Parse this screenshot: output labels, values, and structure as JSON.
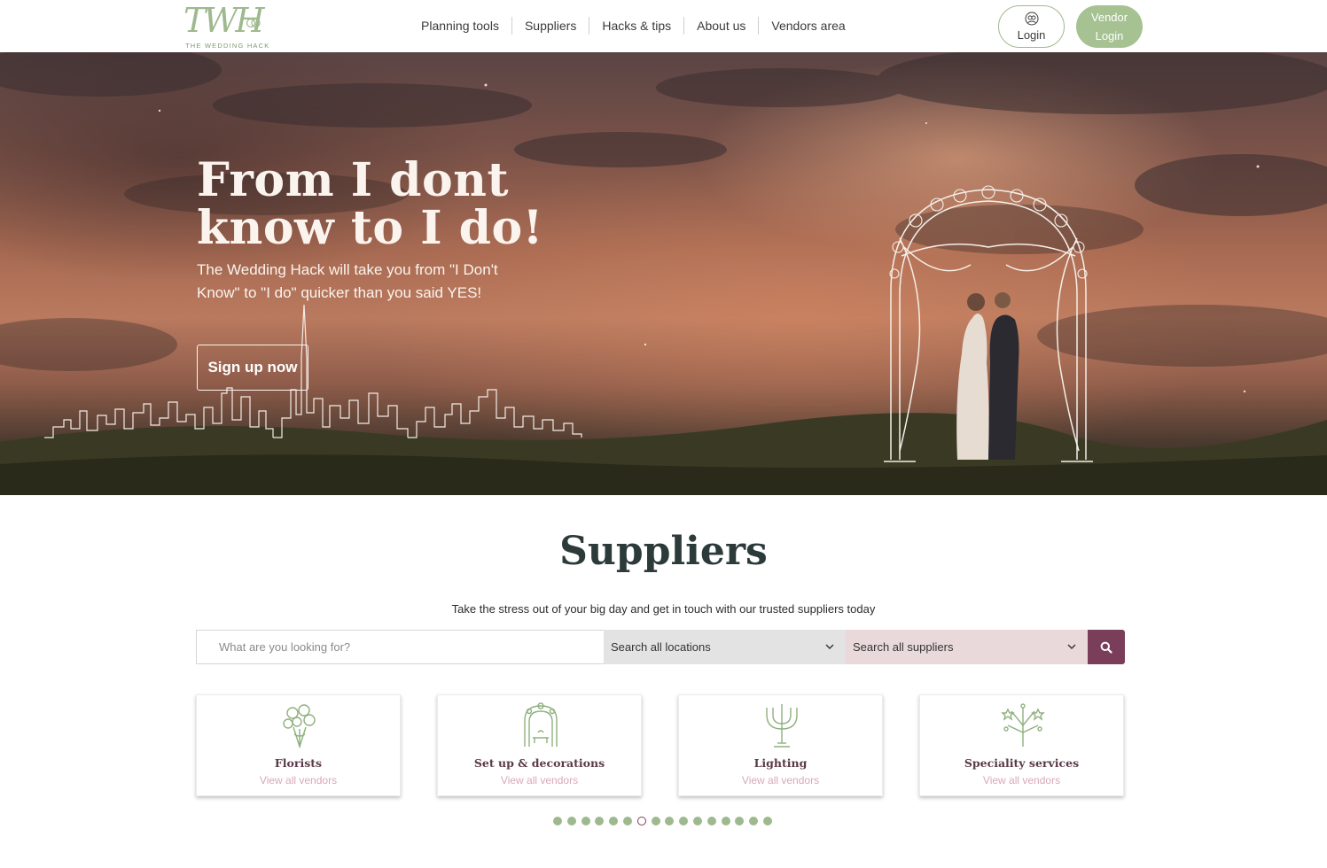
{
  "header": {
    "logo_mark": "TWH",
    "logo_text": "THE WEDDING HACK",
    "nav": [
      "Planning tools",
      "Suppliers",
      "Hacks & tips",
      "About us",
      "Vendors area"
    ],
    "login_label": "Login",
    "vendor_login_line1": "Vendor",
    "vendor_login_line2": "Login"
  },
  "hero": {
    "title": "From I dont know to I do!",
    "subtitle": "The Wedding Hack will take you from \"I Don't Know\" to \"I do\" quicker than you said YES!",
    "cta": "Sign up now"
  },
  "suppliers": {
    "title": "Suppliers",
    "subtitle": "Take the stress out of your big day and get in touch with our trusted suppliers today",
    "search_placeholder": "What are you looking for?",
    "location_select": "Search all locations",
    "supplier_select": "Search all suppliers",
    "cards": [
      {
        "name": "Florists",
        "link": "View all vendors",
        "icon": "bouquet-icon"
      },
      {
        "name": "Set up & decorations",
        "link": "View all vendors",
        "icon": "wedding-arch-icon"
      },
      {
        "name": "Lighting",
        "link": "View all vendors",
        "icon": "candelabra-icon"
      },
      {
        "name": "Speciality services",
        "link": "View all vendors",
        "icon": "fireworks-icon"
      }
    ],
    "carousel_dot_count": 16,
    "carousel_active_index": 6
  },
  "colors": {
    "accent_green": "#a6c192",
    "accent_plum": "#7a3e5a",
    "card_link_pink": "#d8a8b8"
  }
}
